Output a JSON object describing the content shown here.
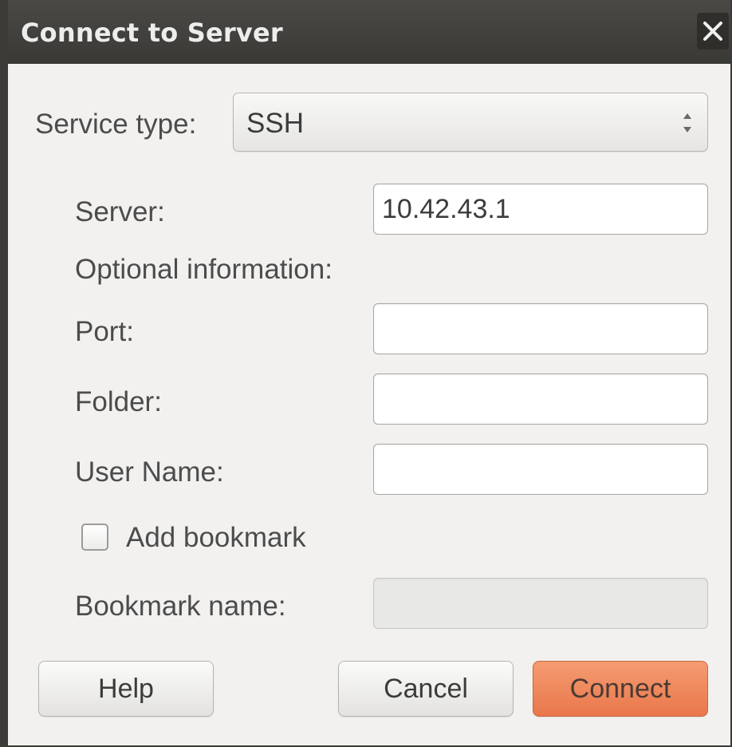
{
  "window": {
    "title": "Connect to Server",
    "close_icon": "close-icon"
  },
  "service": {
    "label": "Service type:",
    "selected": "SSH",
    "spin_icon": "updown-arrows-icon"
  },
  "server": {
    "label": "Server:",
    "value": "10.42.43.1"
  },
  "optional": {
    "heading": "Optional information:",
    "port_label": "Port:",
    "port_value": "",
    "folder_label": "Folder:",
    "folder_value": "",
    "user_label": "User Name:",
    "user_value": ""
  },
  "bookmark": {
    "checkbox_label": "Add bookmark",
    "checked": false,
    "name_label": "Bookmark name:",
    "name_value": ""
  },
  "buttons": {
    "help": "Help",
    "cancel": "Cancel",
    "connect": "Connect"
  },
  "colors": {
    "titlebar": "#3c3b37",
    "accent": "#ee8553",
    "background": "#f2f1f0"
  }
}
